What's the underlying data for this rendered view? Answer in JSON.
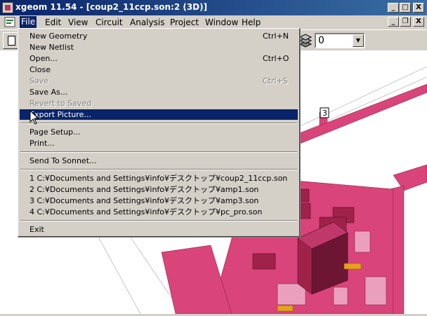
{
  "window": {
    "title": "xgeom 11.54 - [coup2_11ccp.son:2 (3D)]",
    "caption_buttons": [
      "_",
      "□",
      "X"
    ],
    "mdi_buttons": [
      "_",
      "❐",
      "X"
    ]
  },
  "menubar": {
    "items": [
      {
        "label": "File",
        "active": true
      },
      {
        "label": "Edit"
      },
      {
        "label": "View"
      },
      {
        "label": "Circuit"
      },
      {
        "label": "Analysis"
      },
      {
        "label": "Project"
      },
      {
        "label": "Window"
      },
      {
        "label": "Help"
      }
    ]
  },
  "toolbar": {
    "layer_combo_value": "0",
    "combo_arrow": "▼",
    "icons": [
      "new-document-icon",
      "layers-icon"
    ]
  },
  "file_menu": {
    "items": [
      {
        "label": "New Geometry",
        "shortcut": "Ctrl+N"
      },
      {
        "label": "New Netlist",
        "shortcut": ""
      },
      {
        "label": "Open...",
        "shortcut": "Ctrl+O"
      },
      {
        "label": "Close",
        "shortcut": ""
      },
      {
        "label": "Save",
        "shortcut": "Ctrl+S",
        "disabled": true
      },
      {
        "label": "Save As...",
        "shortcut": ""
      },
      {
        "label": "Revert to Saved",
        "shortcut": "",
        "disabled": true
      },
      {
        "label": "Export Picture...",
        "shortcut": "",
        "selected": true
      },
      {
        "label": "Page Setup...",
        "shortcut": ""
      },
      {
        "label": "Print...",
        "shortcut": ""
      },
      {
        "label": "Send To Sonnet...",
        "shortcut": ""
      },
      {
        "label": "1 C:¥Documents and Settings¥info¥デスクトップ¥coup2_11ccp.son",
        "shortcut": ""
      },
      {
        "label": "2 C:¥Documents and Settings¥info¥デスクトップ¥amp1.son",
        "shortcut": ""
      },
      {
        "label": "3 C:¥Documents and Settings¥info¥デスクトップ¥amp3.son",
        "shortcut": ""
      },
      {
        "label": "4 C:¥Documents and Settings¥info¥デスクトップ¥pc_pro.son",
        "shortcut": ""
      },
      {
        "label": "Exit",
        "shortcut": ""
      }
    ]
  },
  "canvas": {
    "port_label": "3",
    "colors": {
      "metal": "#d9447a",
      "via": "#a0224a",
      "via_dark": "#6d1634",
      "pad": "#e6a020",
      "line": "#c8c8c8"
    }
  }
}
